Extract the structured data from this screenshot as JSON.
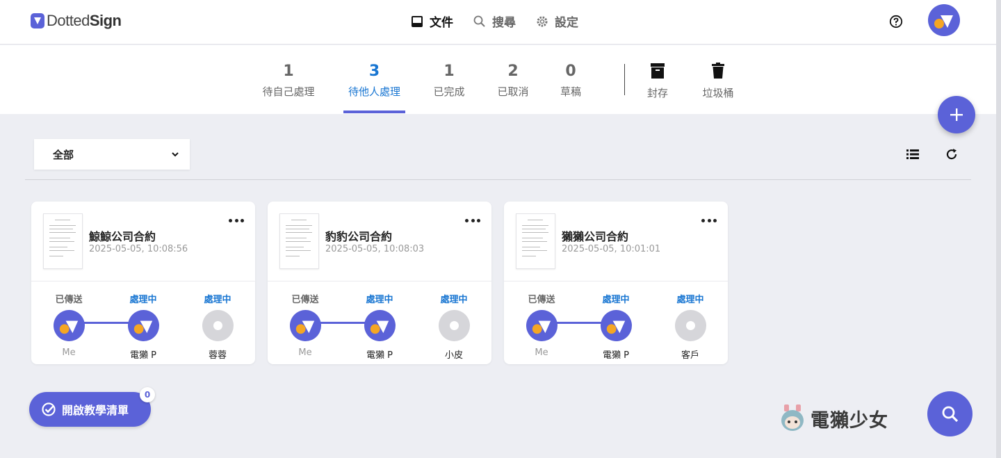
{
  "app": {
    "logo_prefix": "Dotted",
    "logo_suffix": "Sign"
  },
  "nav": [
    {
      "label": "文件",
      "icon": "inbox-icon",
      "active": true
    },
    {
      "label": "搜尋",
      "icon": "search-icon",
      "active": false
    },
    {
      "label": "設定",
      "icon": "gear-icon",
      "active": false
    }
  ],
  "tabs": [
    {
      "count": "1",
      "label": "待自己處理"
    },
    {
      "count": "3",
      "label": "待他人處理",
      "active": true
    },
    {
      "count": "1",
      "label": "已完成"
    },
    {
      "count": "2",
      "label": "已取消"
    },
    {
      "count": "0",
      "label": "草稿"
    },
    {
      "label": "封存",
      "icon": "archive-icon"
    },
    {
      "label": "垃圾桶",
      "icon": "trash-icon"
    }
  ],
  "filter": {
    "selected": "全部"
  },
  "cards": [
    {
      "title": "鯨鯨公司合約",
      "date": "2025-05-05, 10:08:56",
      "steps": [
        {
          "status": "已傳送",
          "name": "Me"
        },
        {
          "status": "處理中",
          "name": "電獺 P"
        },
        {
          "status": "處理中",
          "name": "蓉蓉"
        }
      ]
    },
    {
      "title": "豹豹公司合約",
      "date": "2025-05-05, 10:08:03",
      "steps": [
        {
          "status": "已傳送",
          "name": "Me"
        },
        {
          "status": "處理中",
          "name": "電獺 P"
        },
        {
          "status": "處理中",
          "name": "小皮"
        }
      ]
    },
    {
      "title": "獺獺公司合約",
      "date": "2025-05-05, 10:01:01",
      "steps": [
        {
          "status": "已傳送",
          "name": "Me"
        },
        {
          "status": "處理中",
          "name": "電獺 P"
        },
        {
          "status": "處理中",
          "name": "客戶"
        }
      ]
    }
  ],
  "tutorial": {
    "label": "開啟教學清單",
    "badge": "0"
  },
  "watermark": {
    "text": "電獺少女"
  },
  "colors": {
    "accent": "#5b62d8",
    "active_blue": "#1976d2",
    "avatar_dot": "#f5a623",
    "background": "#edeef3"
  }
}
